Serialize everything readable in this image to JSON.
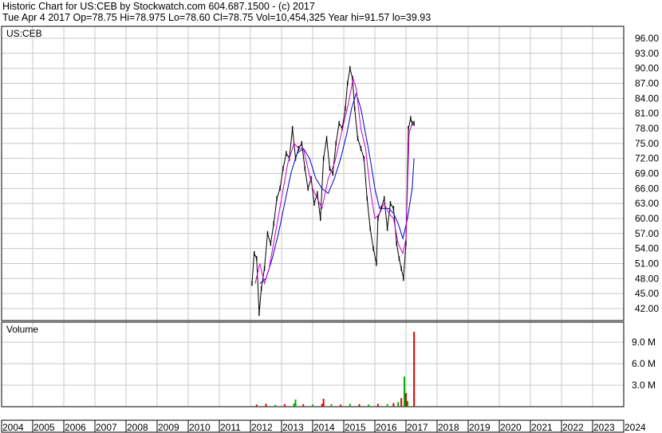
{
  "header": {
    "line1": "Historic Chart for US:CEB by Stockwatch.com 604.687.1500 - (c) 2017",
    "line2": "Tue Apr  4 2017   Op=78.75  Hi=78.975  Lo=78.60  Cl=78.75  Vol=10,454,325  Year hi=91.57  lo=39.93"
  },
  "colors": {
    "price": "#000000",
    "ma_short": "#cc00cc",
    "ma_long": "#0000cc",
    "vol_green": "#00aa00",
    "vol_red": "#dd0000",
    "grid": "#c8c8c8"
  },
  "chart_data": [
    {
      "type": "line",
      "label": "US:CEB",
      "x_axis": {
        "ticks": [
          "2004",
          "2005",
          "2006",
          "2007",
          "2008",
          "2009",
          "2010",
          "2011",
          "2012",
          "2013",
          "2014",
          "2015",
          "2016",
          "2017",
          "2018",
          "2019",
          "2020",
          "2021",
          "2022",
          "2023",
          "2024"
        ],
        "range": [
          2004,
          2024
        ]
      },
      "y_axis": {
        "ticks": [
          "42.00",
          "45.00",
          "48.00",
          "51.00",
          "54.00",
          "57.00",
          "60.00",
          "63.00",
          "66.00",
          "69.00",
          "72.00",
          "75.00",
          "78.00",
          "81.00",
          "84.00",
          "87.00",
          "90.00",
          "93.00",
          "96.00"
        ],
        "ylim": [
          39.6,
          98.4
        ]
      },
      "grid": true,
      "price_series": {
        "x": [
          2012.05,
          2012.12,
          2012.2,
          2012.28,
          2012.35,
          2012.45,
          2012.55,
          2012.65,
          2012.75,
          2012.85,
          2012.95,
          2013.05,
          2013.15,
          2013.25,
          2013.35,
          2013.45,
          2013.55,
          2013.65,
          2013.75,
          2013.85,
          2013.95,
          2014.05,
          2014.15,
          2014.25,
          2014.35,
          2014.45,
          2014.55,
          2014.65,
          2014.75,
          2014.85,
          2014.95,
          2015.05,
          2015.12,
          2015.2,
          2015.28,
          2015.35,
          2015.45,
          2015.55,
          2015.65,
          2015.75,
          2015.85,
          2015.95,
          2016.05,
          2016.1,
          2016.2,
          2016.3,
          2016.4,
          2016.5,
          2016.6,
          2016.7,
          2016.78,
          2016.85,
          2016.92,
          2017.0,
          2017.08,
          2017.15,
          2017.2,
          2017.26
        ],
        "y": [
          47,
          53,
          52,
          41,
          46,
          50,
          57,
          55,
          59,
          64,
          66,
          70,
          73,
          72,
          78,
          72,
          74,
          75,
          70,
          66,
          68,
          63,
          65,
          60,
          72,
          76,
          70,
          69,
          75,
          79,
          78,
          82,
          87,
          90,
          88,
          82,
          76,
          74,
          72,
          64,
          58,
          54,
          51,
          60,
          62,
          64,
          58,
          63,
          62,
          55,
          52,
          50,
          48,
          55,
          78,
          80,
          79,
          79
        ]
      },
      "ma_short": {
        "x": [
          2012.15,
          2012.3,
          2012.45,
          2012.6,
          2012.8,
          2013.0,
          2013.2,
          2013.4,
          2013.55,
          2013.7,
          2013.85,
          2014.0,
          2014.15,
          2014.3,
          2014.5,
          2014.7,
          2014.85,
          2015.0,
          2015.15,
          2015.3,
          2015.4,
          2015.55,
          2015.7,
          2015.85,
          2016.0,
          2016.15,
          2016.3,
          2016.45,
          2016.6,
          2016.75,
          2016.9,
          2017.0,
          2017.1,
          2017.2
        ],
        "y": [
          47,
          51,
          47,
          50,
          57,
          64,
          71,
          75,
          74,
          74,
          70,
          66,
          64,
          62,
          68,
          71,
          75,
          79,
          83,
          88,
          86,
          78,
          74,
          66,
          60,
          61,
          63,
          61,
          60,
          55,
          53,
          56,
          77,
          79
        ]
      },
      "ma_long": {
        "x": [
          2012.3,
          2012.5,
          2012.7,
          2012.9,
          2013.1,
          2013.3,
          2013.5,
          2013.7,
          2013.9,
          2014.1,
          2014.3,
          2014.5,
          2014.7,
          2014.9,
          2015.1,
          2015.25,
          2015.4,
          2015.55,
          2015.7,
          2015.85,
          2016.0,
          2016.15,
          2016.3,
          2016.45,
          2016.6,
          2016.75,
          2016.9,
          2017.05,
          2017.2,
          2017.26
        ],
        "y": [
          47,
          48,
          52,
          57,
          63,
          69,
          73,
          74,
          72,
          68,
          66,
          65,
          68,
          72,
          77,
          82,
          85,
          82,
          77,
          72,
          66,
          62,
          62,
          62,
          61,
          59,
          56,
          60,
          66,
          72
        ]
      }
    },
    {
      "type": "bar",
      "label": "Volume",
      "y_axis": {
        "ticks": [
          "3.0 M",
          "6.0 M",
          "9.0 M"
        ],
        "ylim": [
          0,
          11800000
        ]
      },
      "grid": true,
      "volume_series": {
        "x": [
          2012.2,
          2012.5,
          2012.8,
          2013.1,
          2013.4,
          2013.45,
          2013.7,
          2014.0,
          2014.3,
          2014.35,
          2014.6,
          2014.9,
          2015.2,
          2015.5,
          2015.8,
          2016.1,
          2016.4,
          2016.6,
          2016.75,
          2016.85,
          2016.95,
          2017.0,
          2017.05,
          2017.26
        ],
        "values": [
          300000,
          400000,
          250000,
          350000,
          450000,
          1000000,
          350000,
          300000,
          400000,
          1100000,
          350000,
          300000,
          400000,
          350000,
          300000,
          400000,
          350000,
          500000,
          650000,
          1200000,
          4200000,
          1900000,
          800000,
          10454325
        ],
        "colors": [
          "red",
          "red",
          "green",
          "red",
          "green",
          "green",
          "red",
          "green",
          "red",
          "red",
          "green",
          "red",
          "green",
          "red",
          "green",
          "red",
          "green",
          "red",
          "green",
          "red",
          "green",
          "red",
          "green",
          "red"
        ]
      }
    }
  ]
}
